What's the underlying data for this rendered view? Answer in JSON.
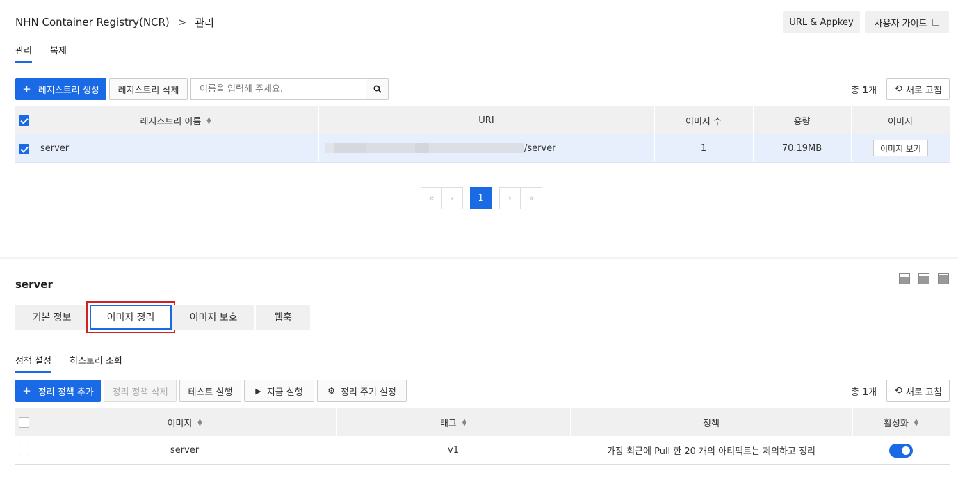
{
  "header": {
    "service": "NHN Container Registry(NCR)",
    "separator": ">",
    "page": "관리",
    "url_appkey": "URL & Appkey",
    "user_guide": "사용자 가이드"
  },
  "top_tabs": [
    {
      "label": "관리",
      "active": true
    },
    {
      "label": "복제",
      "active": false
    }
  ],
  "toolbar": {
    "create": "레지스트리 생성",
    "delete": "레지스트리 삭제",
    "search_placeholder": "이름을 입력해 주세요.",
    "total_prefix": "총",
    "total_count": "1",
    "total_suffix": "개",
    "refresh": "새로 고침"
  },
  "registry_table": {
    "columns": [
      "레지스트리 이름",
      "URI",
      "이미지 수",
      "용량",
      "이미지"
    ],
    "rows": [
      {
        "name": "server",
        "uri_suffix": "/server",
        "image_count": "1",
        "size": "70.19MB",
        "action": "이미지 보기",
        "checked": true
      }
    ]
  },
  "pagination": {
    "current": "1",
    "first": "«",
    "prev": "‹",
    "next": "›",
    "last": "»"
  },
  "detail": {
    "title": "server",
    "tabs": [
      "기본 정보",
      "이미지 정리",
      "이미지 보호",
      "웹훅"
    ],
    "active_tab": "이미지 정리",
    "subtabs": [
      "정책 설정",
      "히스토리 조회"
    ],
    "toolbar": {
      "add": "정리 정책 추가",
      "delete": "정리 정책 삭제",
      "test": "테스트 실행",
      "run_now": "지금 실행",
      "cycle": "정리 주기 설정",
      "total_prefix": "총",
      "total_count": "1",
      "total_suffix": "개",
      "refresh": "새로 고침"
    },
    "policy_table": {
      "columns": [
        "이미지",
        "태그",
        "정책",
        "활성화"
      ],
      "rows": [
        {
          "image": "server",
          "tag": "v1",
          "policy": "가장 최근에 Pull 한 20 개의 아티팩트는 제외하고 정리",
          "enabled": true
        }
      ]
    }
  },
  "colors": {
    "primary": "#1a6ae6",
    "highlight": "#e8effc",
    "header_bg": "#f0f0f0",
    "focus_border": "#e02020"
  }
}
